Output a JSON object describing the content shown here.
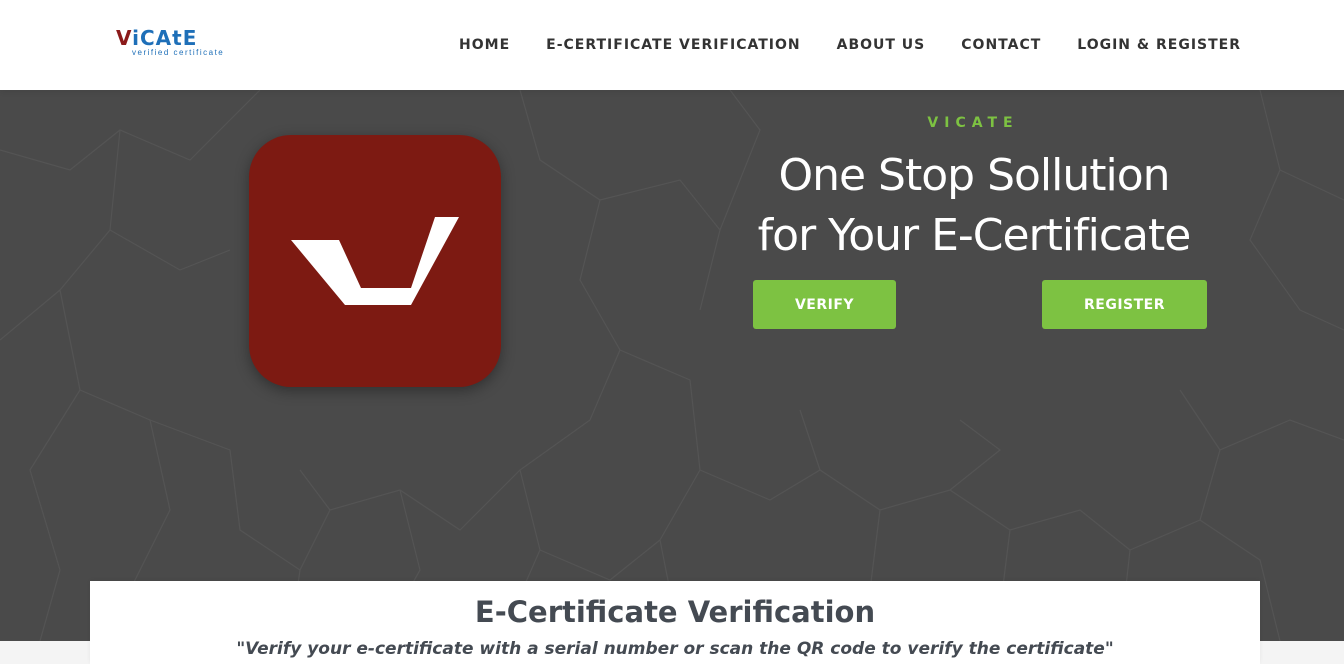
{
  "brand": {
    "logo_v": "V",
    "logo_rest": "iCAtE",
    "logo_tagline": "verified certificate"
  },
  "nav": {
    "items": [
      {
        "label": "HOME"
      },
      {
        "label": "E-CERTIFICATE VERIFICATION"
      },
      {
        "label": "ABOUT US"
      },
      {
        "label": "CONTACT"
      },
      {
        "label": "LOGIN & REGISTER"
      }
    ]
  },
  "hero": {
    "eyebrow": "VICATE",
    "headline_line1": "One Stop Sollution",
    "headline_line2": "for Your E-Certificate",
    "verify_label": "VERIFY",
    "register_label": "REGISTER",
    "app_icon": "vicate-v-icon"
  },
  "verification": {
    "title": "E-Certificate Verification",
    "subtitle": "\"Verify your e-certificate with a serial number or scan the QR code to verify the certificate\""
  },
  "colors": {
    "accent_green": "#7dc242",
    "brand_red": "#7d1a12",
    "brand_blue": "#1e6fb8",
    "hero_bg": "#4a4a4a",
    "text_dark": "#444a52"
  }
}
